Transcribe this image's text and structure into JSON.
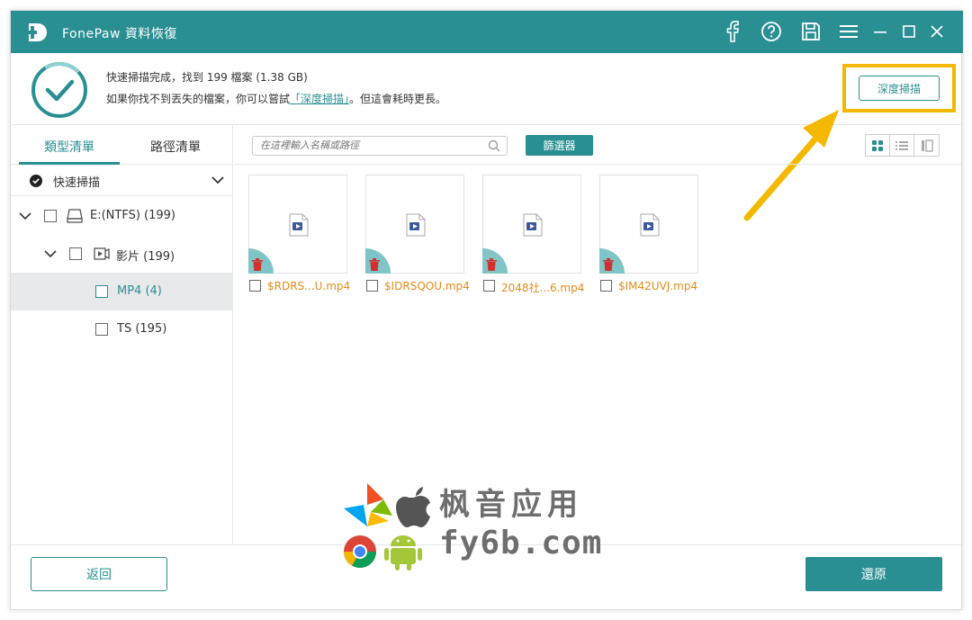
{
  "window": {
    "app_title": "FonePaw  資料恢復",
    "accent_color": "#2a8f93"
  },
  "titlebar_icons": [
    "facebook-icon",
    "help-icon",
    "save-icon",
    "menu-icon",
    "minimize-icon",
    "maximize-icon",
    "close-icon"
  ],
  "info": {
    "line1": "快速掃描完成，找到 199 檔案 (1.38 GB)",
    "line2_prefix": "如果你找不到丟失的檔案，你可以嘗試",
    "line2_link": "「深度掃描」",
    "line2_suffix": "。但這會耗時更長。",
    "deep_scan_button": "深度掃描"
  },
  "sidebar": {
    "tabs": [
      {
        "label": "類型清單",
        "active": true
      },
      {
        "label": "路徑清單",
        "active": false
      }
    ],
    "scan_mode": "快速掃描",
    "tree": [
      {
        "label": "E:(NTFS) (199)"
      },
      {
        "label": "影片 (199)"
      },
      {
        "label": "MP4 (4)",
        "selected": true
      },
      {
        "label": "TS (195)"
      }
    ]
  },
  "toolbar": {
    "search_placeholder": "在這裡輸入名稱或路徑",
    "filter_button": "篩選器"
  },
  "files": [
    {
      "name": "$RDRS...U.mp4"
    },
    {
      "name": "$IDRSQOU.mp4"
    },
    {
      "name": "2048社...6.mp4"
    },
    {
      "name": "$IM42UVJ.mp4"
    }
  ],
  "footer": {
    "back_button": "返回",
    "restore_button": "還原"
  },
  "watermark": {
    "line1": "枫音应用",
    "line2": "fy6b.com"
  }
}
